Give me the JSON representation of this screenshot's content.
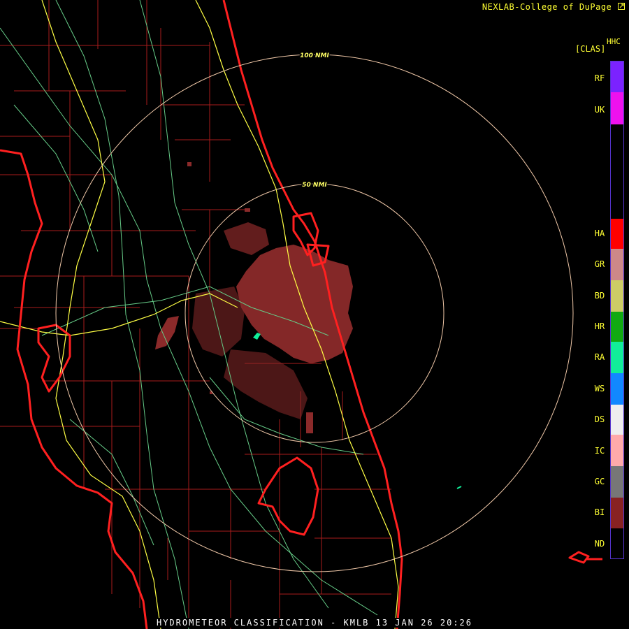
{
  "credit": "NEXLAB-College of DuPage",
  "credit_icon": "external-link-icon",
  "footer": "HYDROMETEOR CLASSIFICATION - KMLB 13 JAN 26 20:26",
  "legend": {
    "title_top": "HHC",
    "title_bottom": "[CLAS]",
    "items": [
      {
        "code": "RF",
        "color": "#7b22ff"
      },
      {
        "code": "UK",
        "color": "#ee11ee"
      },
      {
        "code": "HA",
        "color": "#ff0000"
      },
      {
        "code": "GR",
        "color": "#cc8888"
      },
      {
        "code": "BD",
        "color": "#cccc66"
      },
      {
        "code": "HR",
        "color": "#11aa11"
      },
      {
        "code": "RA",
        "color": "#11ee99"
      },
      {
        "code": "WS",
        "color": "#1188ff"
      },
      {
        "code": "DS",
        "color": "#eeeeee"
      },
      {
        "code": "IC",
        "color": "#ffaaaa"
      },
      {
        "code": "GC",
        "color": "#777777"
      },
      {
        "code": "BI",
        "color": "#882222"
      },
      {
        "code": "ND",
        "color": "#000000"
      }
    ]
  },
  "range_rings": [
    {
      "label": "100 NMI"
    },
    {
      "label": "50 NMI"
    }
  ],
  "colors": {
    "coast": "#ff2020",
    "county": "#b02020",
    "highway_major": "#ffff44",
    "highway_minor": "#66cc88",
    "ring": "#f0c8a8",
    "echo": "#8b2a2a"
  }
}
